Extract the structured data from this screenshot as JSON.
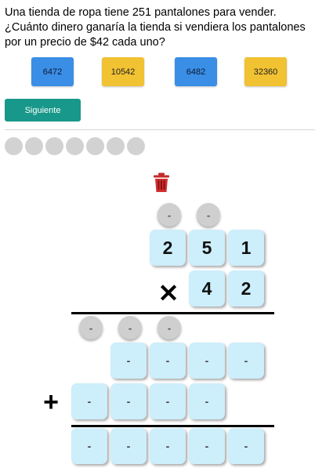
{
  "question": "Una tienda de ropa tiene 251 pantalones para vender. ¿Cuánto dinero ganaría la tienda si vendiera los pantalones por un precio de $42 cada uno?",
  "options": [
    {
      "label": "6472",
      "color": "#3a8ee6"
    },
    {
      "label": "10542",
      "color": "#f1c232"
    },
    {
      "label": "6482",
      "color": "#3a8ee6"
    },
    {
      "label": "32360",
      "color": "#f1c232"
    }
  ],
  "next_button": "Siguiente",
  "progress_dot_count": 7,
  "multiplication": {
    "carries_top": [
      "-",
      "-"
    ],
    "multiplicand": [
      "2",
      "5",
      "1"
    ],
    "multiply_sign": "✕",
    "multiplier": [
      "4",
      "2"
    ],
    "carries_partial": [
      "-",
      "-",
      "-"
    ],
    "partial_1": [
      "-",
      "-",
      "-",
      "-"
    ],
    "plus_sign": "+",
    "partial_2": [
      "-",
      "-",
      "-",
      "-"
    ],
    "result": [
      "-",
      "-",
      "-",
      "-",
      "-"
    ]
  },
  "colors": {
    "cell": "#cdeefb",
    "carry": "#cfcfcf",
    "trash": "#d32f2f",
    "next_button": "#17988a"
  }
}
